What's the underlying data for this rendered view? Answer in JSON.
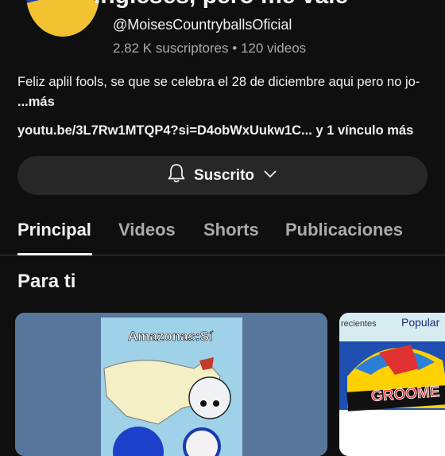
{
  "channel": {
    "title": "Ingleses, pero me vale",
    "handle": "@MoisesCountryballsOficial",
    "subscribers": "2.82 K suscriptores",
    "separator": "•",
    "videos_count": "120 videos",
    "description": "Feliz aplil fools, se que se celebra el 28 de diciembre aqui pero no jo-",
    "more_label": " ...más",
    "links_text": "youtu.be/3L7Rw1MTQP4?si=D4obWxUukw1C... y 1 vínculo más"
  },
  "subscribe_button": {
    "label": "Suscrito"
  },
  "tabs": [
    {
      "label": "Principal",
      "active": true
    },
    {
      "label": "Videos"
    },
    {
      "label": "Shorts"
    },
    {
      "label": "Publicaciones"
    }
  ],
  "section": {
    "title": "Para ti"
  },
  "thumbnails": [
    {
      "overlay_text": "Amazonas:Sí"
    },
    {
      "overlay_text_1": "recientes",
      "overlay_text_2": "Popular",
      "overlay_text_3": "GROOME"
    }
  ],
  "colors": {
    "background": "#0f0f0f",
    "text": "#f1f1f1",
    "muted": "#aaaaaa",
    "button": "#272727"
  }
}
